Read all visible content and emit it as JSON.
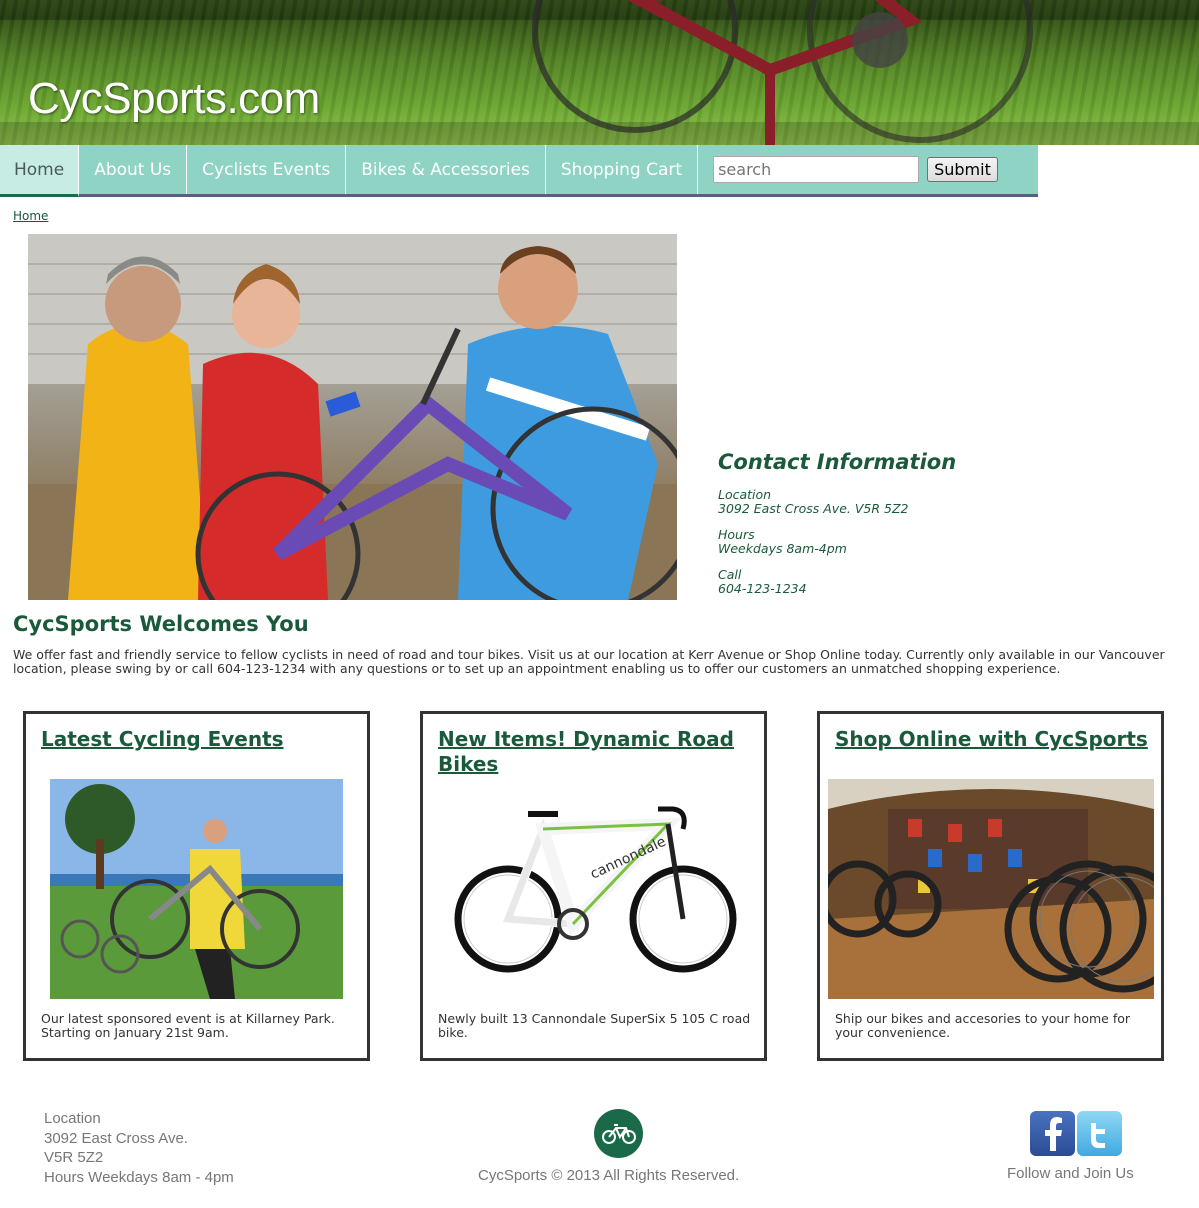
{
  "header": {
    "site_title": "CycSports.com"
  },
  "nav": {
    "items": [
      {
        "label": "Home",
        "active": true
      },
      {
        "label": "About Us"
      },
      {
        "label": "Cyclists Events"
      },
      {
        "label": "Bikes & Accessories"
      },
      {
        "label": "Shopping Cart"
      }
    ],
    "search_placeholder": "search",
    "submit_label": "Submit"
  },
  "breadcrumb": "Home",
  "contact": {
    "title": "Contact Information",
    "location_label": "Location",
    "location_value": "3092 East Cross Ave. V5R 5Z2",
    "hours_label": "Hours",
    "hours_value": "Weekdays 8am-4pm",
    "call_label": "Call",
    "call_value": "604-123-1234"
  },
  "welcome": {
    "title": "CycSports Welcomes You",
    "text": "We offer fast and friendly service to fellow cyclists in need of road and tour bikes. Visit us at our location at Kerr Avenue or Shop Online today. Currently only available in our Vancouver location, please swing by or call 604-123-1234 with any questions or to set up an appointment enabling us to offer our customers an unmatched shopping experience."
  },
  "cards": [
    {
      "title": "Latest Cycling Events",
      "text": "Our latest sponsored event is at Killarney Park. Starting on January 21st 9am."
    },
    {
      "title": "New Items! Dynamic Road Bikes",
      "text": "Newly built 13 Cannondale SuperSix 5 105 C road bike."
    },
    {
      "title": "Shop Online with CycSports",
      "text": "Ship our bikes and accesories to your home for your convenience."
    }
  ],
  "footer": {
    "location_lines": [
      "Location",
      "3092 East Cross Ave.",
      "V5R 5Z2",
      "Hours Weekdays 8am - 4pm"
    ],
    "copyright": "CycSports © 2013 All Rights Reserved.",
    "follow": "Follow and Join Us"
  },
  "colors": {
    "brand_green": "#1a5a3a",
    "nav_bg": "#8fd3c4",
    "nav_border": "#5a5e84"
  }
}
